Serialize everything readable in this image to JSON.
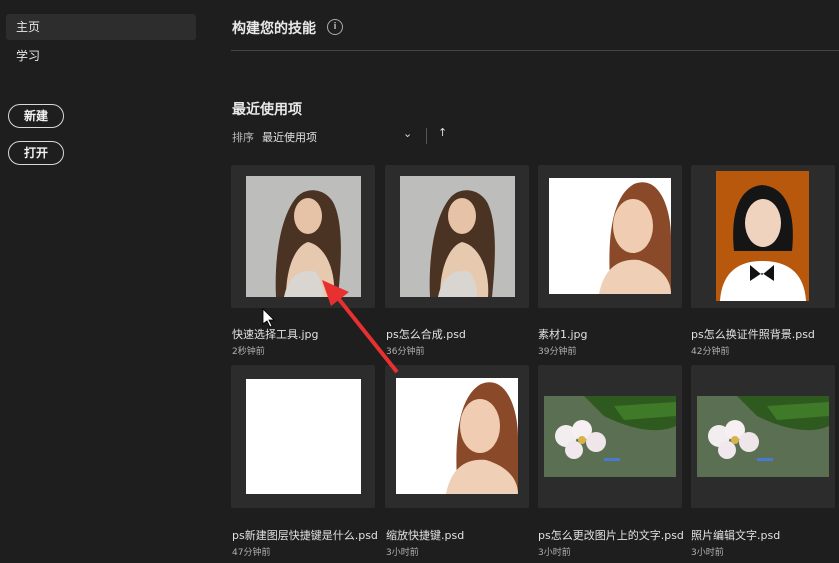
{
  "sidebar": {
    "items": [
      {
        "label": "主页",
        "active": true
      },
      {
        "label": "学习",
        "active": false
      }
    ],
    "new_button": "新建",
    "open_button": "打开"
  },
  "main": {
    "skills_title": "构建您的技能",
    "recent_title": "最近使用项",
    "sort_label": "排序",
    "sort_value": "最近使用项"
  },
  "files": [
    {
      "name": "快速选择工具.jpg",
      "time": "2秒钟前",
      "thumb": "woman-gray"
    },
    {
      "name": "ps怎么合成.psd",
      "time": "36分钟前",
      "thumb": "woman-gray"
    },
    {
      "name": "素材1.jpg",
      "time": "39分钟前",
      "thumb": "woman-white"
    },
    {
      "name": "ps怎么换证件照背景.psd",
      "time": "42分钟前",
      "thumb": "id-photo-orange"
    },
    {
      "name": "ps新建图层快捷键是什么.psd",
      "time": "47分钟前",
      "thumb": "blank-white"
    },
    {
      "name": "缩放快捷键.psd",
      "time": "3小时前",
      "thumb": "woman-white"
    },
    {
      "name": "ps怎么更改图片上的文字.psd",
      "time": "3小时前",
      "thumb": "flowers"
    },
    {
      "name": "照片编辑文字.psd",
      "time": "3小时前",
      "thumb": "flowers"
    }
  ],
  "colors": {
    "background": "#1e1e1e",
    "card": "#2c2c2c",
    "annotation_arrow": "#e83030"
  }
}
